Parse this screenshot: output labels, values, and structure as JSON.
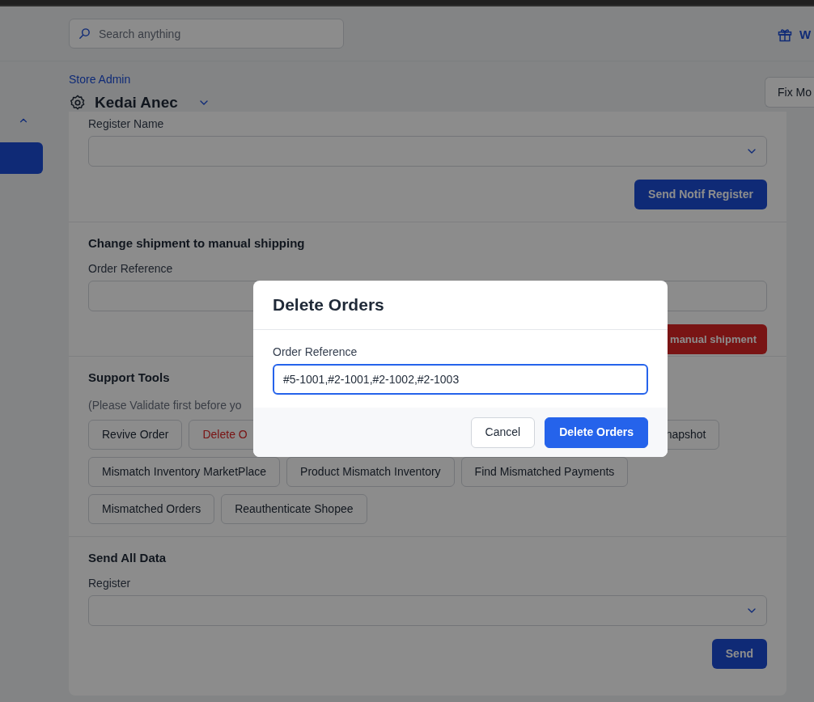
{
  "header": {
    "search_placeholder": "Search anything",
    "link_text": "W"
  },
  "sidebar": {
    "group_expanded": true,
    "items": [
      {
        "selected": true
      }
    ]
  },
  "store": {
    "subtitle": "Store Admin",
    "name": "Kedai Anec",
    "action_button": "Fix Mo"
  },
  "sections": [
    {
      "field": {
        "label": "Register Name",
        "kind": "select"
      },
      "button": {
        "label": "Send Notif Register",
        "kind": "primary"
      }
    },
    {
      "title": "Change shipment to manual shipping",
      "field": {
        "label": "Order Reference",
        "kind": "text"
      },
      "button": {
        "label": "manual shipment",
        "kind": "danger"
      }
    },
    {
      "title": "Support Tools",
      "note": "(Please Validate first before yo",
      "tool_rows": [
        [
          {
            "label": "Revive Order",
            "danger": false
          },
          {
            "label": "Delete O",
            "danger": true
          },
          {
            "label": "napshot",
            "danger": false
          }
        ],
        [
          {
            "label": "Mismatch Inventory MarketPlace",
            "danger": false
          },
          {
            "label": "Product Mismatch Inventory",
            "danger": false
          },
          {
            "label": "Find Mismatched Payments",
            "danger": false
          }
        ],
        [
          {
            "label": "Mismatched Orders",
            "danger": false
          },
          {
            "label": "Reauthenticate Shopee",
            "danger": false
          }
        ]
      ]
    },
    {
      "title": "Send All Data",
      "field": {
        "label": "Register",
        "kind": "select"
      },
      "button": {
        "label": "Send",
        "kind": "primary"
      }
    }
  ],
  "modal": {
    "title": "Delete Orders",
    "field_label": "Order Reference",
    "value": "#5-1001,#2-1001,#2-1002,#2-1003",
    "focused": true,
    "buttons": [
      {
        "label": "Cancel",
        "kind": "secondary"
      },
      {
        "label": "Delete Orders",
        "kind": "primary"
      }
    ]
  }
}
